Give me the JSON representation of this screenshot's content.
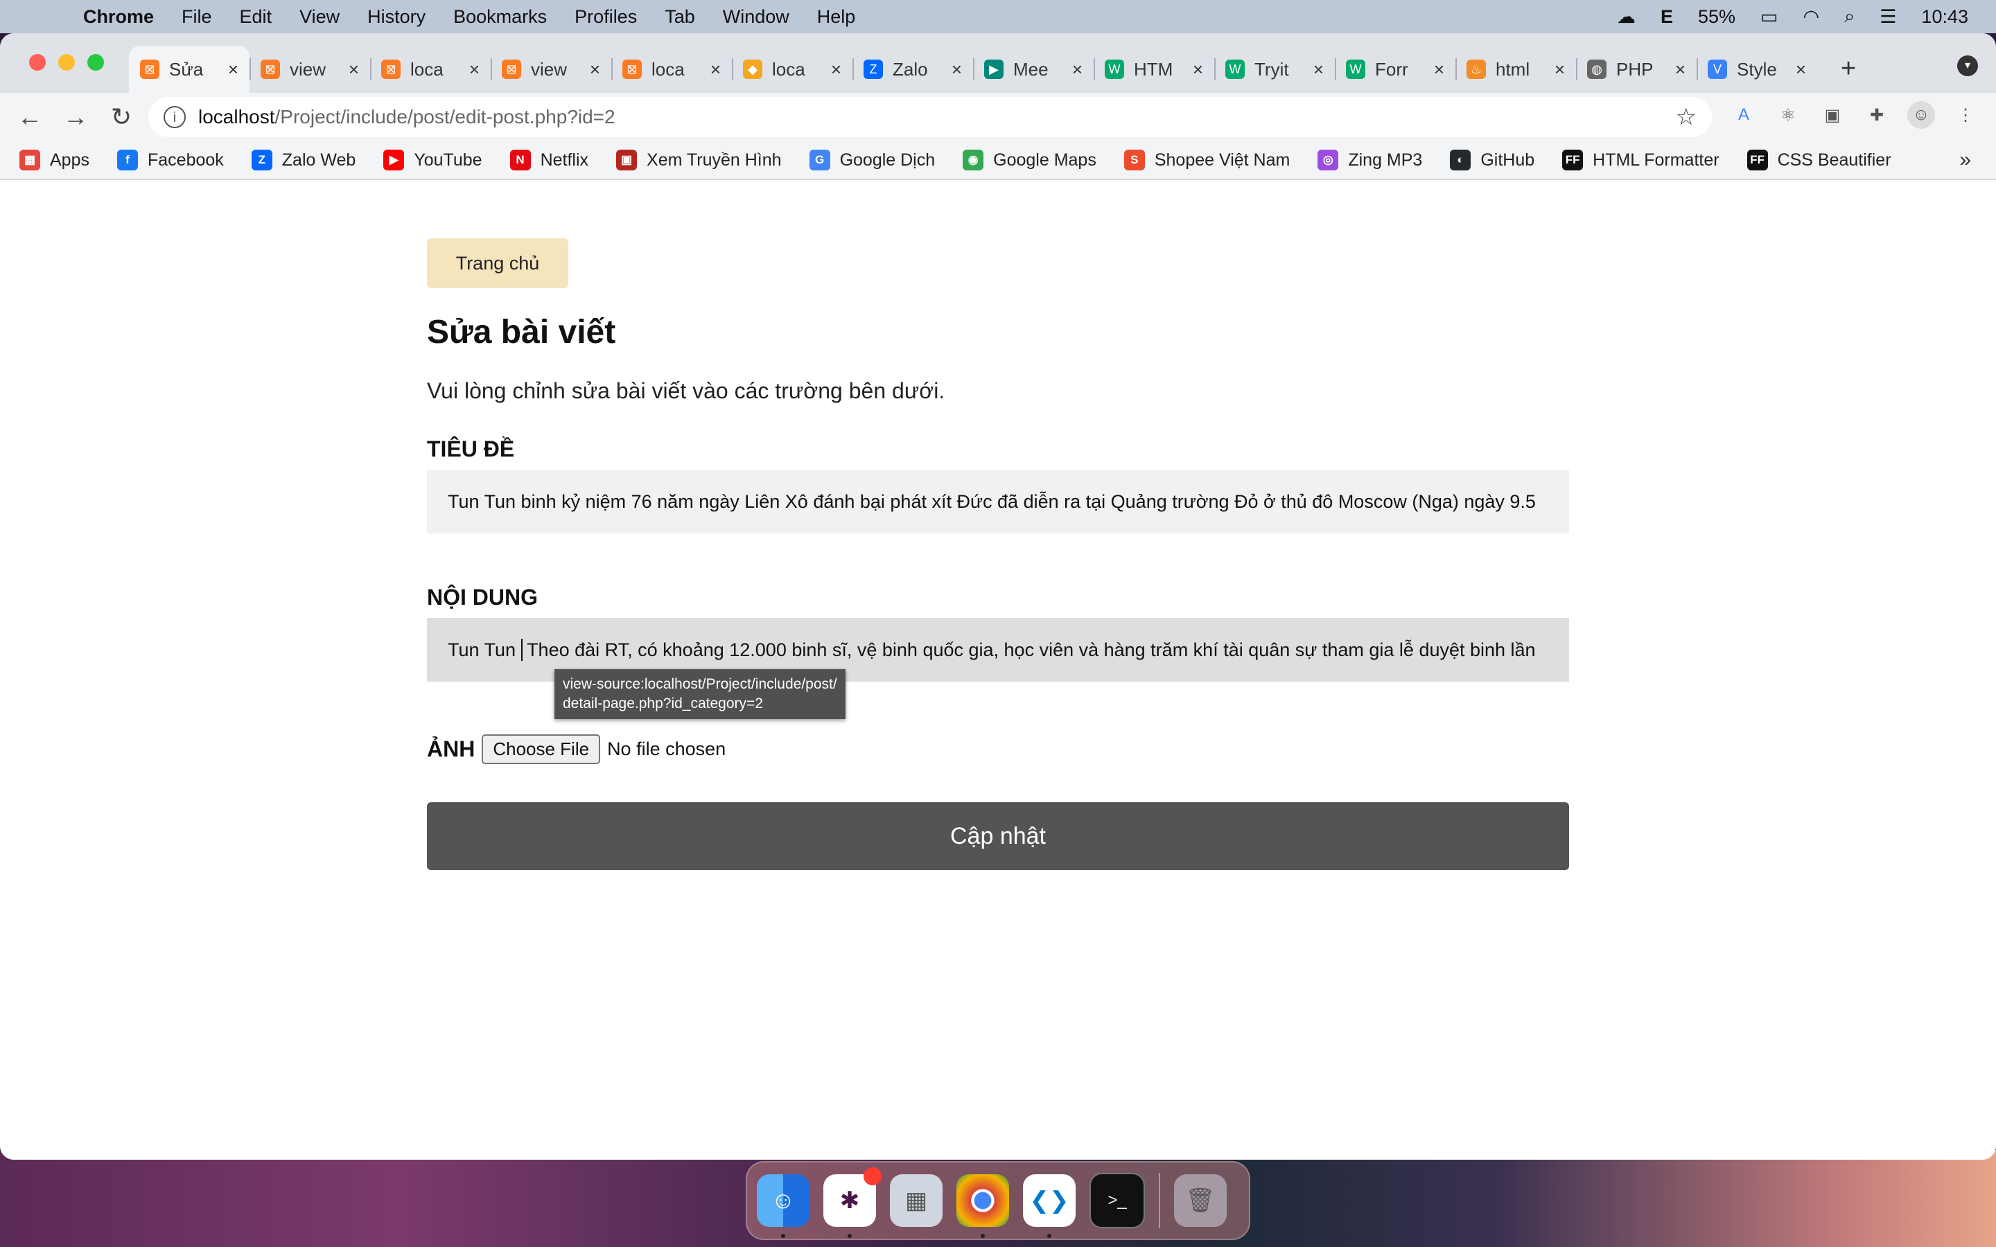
{
  "menubar": {
    "app": "Chrome",
    "items": [
      "File",
      "Edit",
      "View",
      "History",
      "Bookmarks",
      "Profiles",
      "Tab",
      "Window",
      "Help"
    ],
    "battery": "55%",
    "clock": "10:43"
  },
  "tabs": [
    {
      "title": "Sửa",
      "icon": "xampp-icon",
      "active": true
    },
    {
      "title": "view",
      "icon": "xampp-icon"
    },
    {
      "title": "loca",
      "icon": "xampp-icon"
    },
    {
      "title": "view",
      "icon": "xampp-icon"
    },
    {
      "title": "loca",
      "icon": "xampp-icon"
    },
    {
      "title": "loca",
      "icon": "phpmyadmin-icon"
    },
    {
      "title": "Zalo",
      "icon": "zalo-icon"
    },
    {
      "title": "Mee",
      "icon": "meet-icon"
    },
    {
      "title": "HTM",
      "icon": "w3schools-icon"
    },
    {
      "title": "Tryit",
      "icon": "w3schools-icon"
    },
    {
      "title": "Forr",
      "icon": "w3schools-icon"
    },
    {
      "title": "html",
      "icon": "flame-icon"
    },
    {
      "title": "PHP",
      "icon": "globe-icon"
    },
    {
      "title": "Style",
      "icon": "v-icon"
    }
  ],
  "address": {
    "host": "localhost",
    "path": "/Project/include/post/edit-post.php?id=2"
  },
  "bookmarks": [
    {
      "label": "Apps",
      "icon": "apps-grid-icon",
      "color": "#e8453c"
    },
    {
      "label": "Facebook",
      "icon": "facebook-icon",
      "color": "#1877f2"
    },
    {
      "label": "Zalo Web",
      "icon": "zalo-icon",
      "color": "#0068ff"
    },
    {
      "label": "YouTube",
      "icon": "youtube-icon",
      "color": "#ff0000"
    },
    {
      "label": "Netflix",
      "icon": "netflix-icon",
      "color": "#e50914"
    },
    {
      "label": "Xem Truyền Hình",
      "icon": "tv-icon",
      "color": "#b3261e"
    },
    {
      "label": "Google Dịch",
      "icon": "translate-icon",
      "color": "#4285f4"
    },
    {
      "label": "Google Maps",
      "icon": "maps-icon",
      "color": "#34a853"
    },
    {
      "label": "Shopee Việt Nam",
      "icon": "shopee-icon",
      "color": "#ee4d2d"
    },
    {
      "label": "Zing MP3",
      "icon": "zing-icon",
      "color": "#9b4de0"
    },
    {
      "label": "GitHub",
      "icon": "github-icon",
      "color": "#24292e"
    },
    {
      "label": "HTML Formatter",
      "icon": "ff-icon",
      "color": "#111111"
    },
    {
      "label": "CSS Beautifier",
      "icon": "ff-icon",
      "color": "#111111"
    }
  ],
  "page": {
    "home_button": "Trang chủ",
    "heading": "Sửa bài viết",
    "lead": "Vui lòng chỉnh sửa bài viết vào các trường bên dưới.",
    "title_label": "TIÊU ĐỀ",
    "title_value": "Tun Tun binh kỷ niệm 76 năm ngày Liên Xô đánh bại phát xít Đức đã diễn ra tại Quảng trường Đỏ ở thủ đô Moscow (Nga) ngày 9.5",
    "content_label": "NỘI DUNG",
    "content_before_caret": "Tun Tun",
    "content_after_caret": "Theo đài RT, có khoảng 12.000 binh sĩ, vệ binh quốc gia, học viên và hàng trăm khí tài quân sự tham gia lễ duyệt binh lần",
    "tooltip_line1": "view-source:localhost/Project/include/post/",
    "tooltip_line2": "detail-page.php?id_category=2",
    "image_label": "ẢNH",
    "file_button": "Choose File",
    "file_status": "No file chosen",
    "submit_label": "Cập nhật"
  },
  "dock": [
    "finder-icon",
    "slack-icon",
    "launchpad-icon",
    "chrome-icon",
    "vscode-icon",
    "terminal-icon",
    "trash-icon"
  ]
}
